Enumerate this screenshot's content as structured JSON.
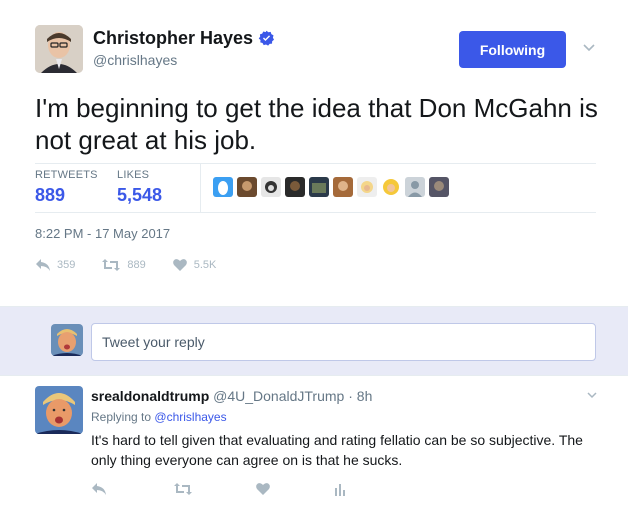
{
  "tweet": {
    "author_name": "Christopher Hayes",
    "author_handle": "@chrislhayes",
    "follow_label": "Following",
    "text": "I'm beginning to get the idea that Don McGahn is not great at his job.",
    "stats": {
      "retweets_label": "RETWEETS",
      "retweets_value": "889",
      "likes_label": "LIKES",
      "likes_value": "5,548"
    },
    "timestamp": "8:22 PM - 17 May 2017",
    "actions": {
      "reply_count": "359",
      "retweet_count": "889",
      "like_count": "5.5K"
    }
  },
  "reply_box": {
    "placeholder": "Tweet your reply"
  },
  "reply": {
    "author_name": "srealdonaldtrump",
    "author_handle": "@4U_DonaldJTrump",
    "separator": "·",
    "time": "8h",
    "replying_prefix": "Replying to",
    "replying_to": "@chrislhayes",
    "text": "It's hard to tell given that evaluating and rating fellatio can be so subjective. The only thing everyone can agree on is that he sucks."
  },
  "colors": {
    "accent": "#3b58e8",
    "muted": "#657786",
    "icon": "#aab8c2",
    "reply_bg": "#e8eaf7"
  }
}
